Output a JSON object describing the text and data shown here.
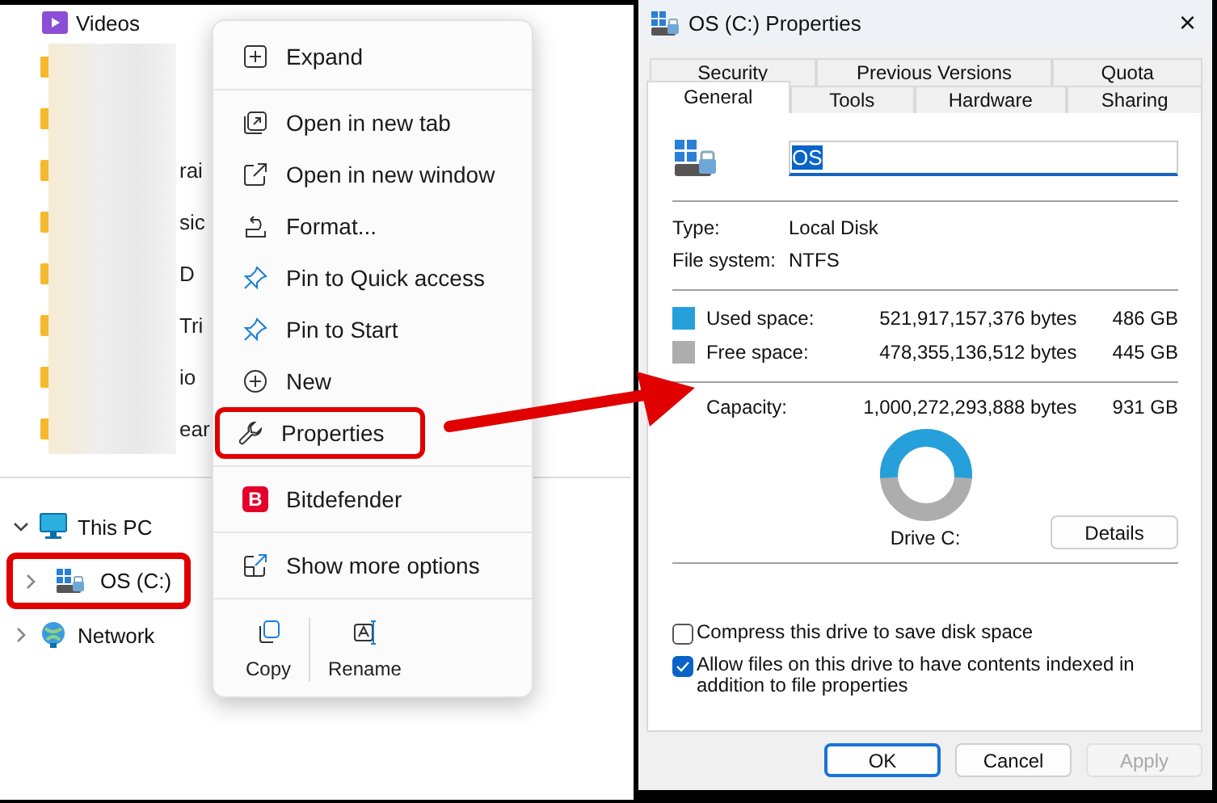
{
  "explorer": {
    "nav_top": {
      "label": "Videos"
    },
    "folders": [
      {
        "kind": "blurred"
      },
      {
        "kind": "blurred"
      },
      {
        "kind": "partial",
        "label_fragment": "rai"
      },
      {
        "kind": "partial",
        "label_fragment": "sic"
      },
      {
        "kind": "partial",
        "label_fragment": "D"
      },
      {
        "kind": "partial",
        "label_fragment": "Tri"
      },
      {
        "kind": "partial",
        "label_fragment": "io"
      },
      {
        "kind": "partial",
        "label_fragment": "ear"
      }
    ],
    "tree": [
      {
        "label": "This PC",
        "expanded": true,
        "highlighted": false,
        "children": [
          {
            "label": "OS (C:)",
            "expanded": false,
            "highlighted": true
          }
        ]
      },
      {
        "label": "Network",
        "expanded": false,
        "highlighted": false
      }
    ]
  },
  "context_menu": {
    "groups": [
      [
        {
          "label": "Expand",
          "highlighted": false
        }
      ],
      [
        {
          "label": "Open in new tab",
          "highlighted": false
        },
        {
          "label": "Open in new window",
          "highlighted": false
        },
        {
          "label": "Format...",
          "highlighted": false
        },
        {
          "label": "Pin to Quick access",
          "highlighted": false
        },
        {
          "label": "Pin to Start",
          "highlighted": false
        },
        {
          "label": "New",
          "highlighted": false
        },
        {
          "label": "Properties",
          "highlighted": true
        }
      ],
      [
        {
          "label": "Bitdefender",
          "badge": "B",
          "highlighted": false
        }
      ],
      [
        {
          "label": "Show more options",
          "highlighted": false
        }
      ]
    ],
    "actions": [
      {
        "label": "Copy"
      },
      {
        "label": "Rename"
      }
    ]
  },
  "dialog": {
    "title": "OS (C:) Properties",
    "close": "×",
    "tab_rows": [
      [
        {
          "label": "Security",
          "selected": false
        },
        {
          "label": "Previous Versions",
          "selected": false
        },
        {
          "label": "Quota",
          "selected": false
        }
      ],
      [
        {
          "label": "General",
          "selected": true
        },
        {
          "label": "Tools",
          "selected": false
        },
        {
          "label": "Hardware",
          "selected": false
        },
        {
          "label": "Sharing",
          "selected": false
        }
      ]
    ],
    "name_field": {
      "value": "OS"
    },
    "info": [
      {
        "label": "Type:",
        "value": "Local Disk"
      },
      {
        "label": "File system:",
        "value": "NTFS"
      }
    ],
    "space": [
      {
        "label": "Used space:",
        "bytes": "521,917,157,376 bytes",
        "size": "486 GB",
        "color": "#26a0da"
      },
      {
        "label": "Free space:",
        "bytes": "478,355,136,512 bytes",
        "size": "445 GB",
        "color": "#adadad"
      }
    ],
    "capacity": {
      "label": "Capacity:",
      "bytes": "1,000,272,293,888 bytes",
      "size": "931 GB"
    },
    "usage_chart": {
      "level": 0.522
    },
    "drive_label": "Drive C:",
    "details_button": "Details",
    "options": [
      {
        "label": "Compress this drive to save disk space",
        "checked": false
      },
      {
        "label": "Allow files on this drive to have contents indexed in addition to file properties",
        "checked": true
      }
    ],
    "buttons": [
      {
        "label": "OK",
        "default": true,
        "disabled": false
      },
      {
        "label": "Cancel",
        "default": false,
        "disabled": false
      },
      {
        "label": "Apply",
        "default": false,
        "disabled": true
      }
    ]
  }
}
